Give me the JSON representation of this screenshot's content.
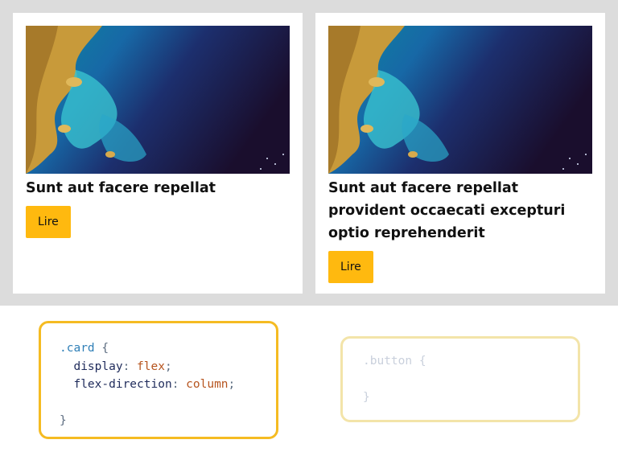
{
  "cards": [
    {
      "title": "Sunt aut facere repellat",
      "button": "Lire"
    },
    {
      "title": "Sunt aut facere repellat provident occaecati excepturi optio reprehenderit",
      "button": "Lire"
    }
  ],
  "code_panels": {
    "card": {
      "selector": ".card",
      "open": "{",
      "close": "}",
      "decls": [
        {
          "prop": "display",
          "value": "flex"
        },
        {
          "prop": "flex-direction",
          "value": "column"
        }
      ]
    },
    "button": {
      "selector": ".button",
      "open": "{",
      "close": "}"
    }
  },
  "colors": {
    "accent": "#ffb90f",
    "panel_border": "#f5bb22",
    "panel_border_faded": "#f3e4a9",
    "band": "#dcdcdc"
  }
}
